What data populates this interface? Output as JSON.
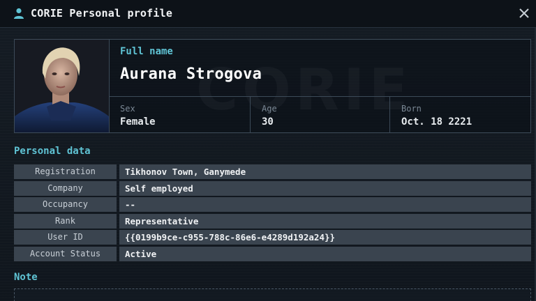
{
  "window": {
    "title": "CORIE Personal profile"
  },
  "profile": {
    "fullname_label": "Full name",
    "fullname": "Aurana Strogova",
    "sex_label": "Sex",
    "sex": "Female",
    "age_label": "Age",
    "age": "30",
    "born_label": "Born",
    "born": "Oct. 18 2221"
  },
  "personal_data": {
    "title": "Personal data",
    "rows": [
      {
        "key": "Registration",
        "value": "Tikhonov Town, Ganymede"
      },
      {
        "key": "Company",
        "value": "Self employed"
      },
      {
        "key": "Occupancy",
        "value": "--"
      },
      {
        "key": "Rank",
        "value": "Representative"
      },
      {
        "key": "User ID",
        "value": "{{0199b9ce-c955-788c-86e6-e4289d192a24}}"
      },
      {
        "key": "Account Status",
        "value": "Active"
      }
    ]
  },
  "note": {
    "title": "Note"
  },
  "icons": {
    "title_icon": "user-icon",
    "close_icon": "close-icon"
  },
  "colors": {
    "accent": "#5fc3d4",
    "row_background": "#3a444f",
    "window_background": "#10161d"
  }
}
